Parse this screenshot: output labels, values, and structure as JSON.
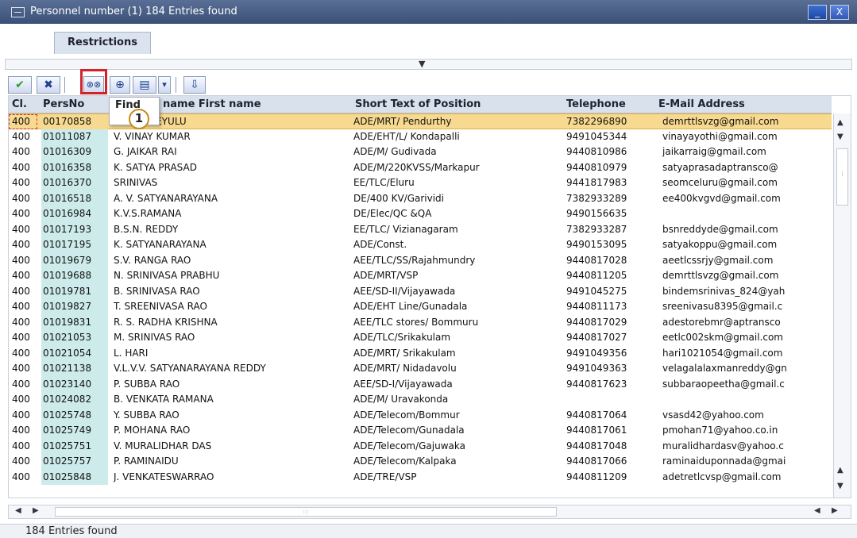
{
  "window": {
    "title": "Personnel number (1)  184 Entries found",
    "minimize_label": "_",
    "close_label": "X"
  },
  "tabs": [
    {
      "label": "Restrictions"
    }
  ],
  "toolbar": {
    "buttons": [
      {
        "name": "continue-button",
        "icon": "check-icon",
        "glyph": "✔"
      },
      {
        "name": "cancel-button",
        "icon": "close-icon",
        "glyph": "✖"
      },
      {
        "name": "find-button",
        "icon": "binoculars-icon",
        "glyph": "⊗⊗"
      },
      {
        "name": "find-next-button",
        "icon": "binoculars-next-icon",
        "glyph": "⊕"
      },
      {
        "name": "print-button",
        "icon": "printer-icon",
        "glyph": "▤"
      },
      {
        "name": "dropdown-button",
        "icon": "dropdown-icon",
        "glyph": "▾"
      },
      {
        "name": "hierarchy-button",
        "icon": "hierarchy-icon",
        "glyph": "⇩"
      }
    ]
  },
  "tooltip": {
    "text": "Find"
  },
  "callout": {
    "number": "1"
  },
  "table": {
    "columns": [
      "Cl.",
      "PersNo",
      "name First name",
      "Short Text of Position",
      "Telephone",
      "E-Mail Address"
    ],
    "rows": [
      [
        "400",
        "00170858",
        "ERANJANEYULU",
        "ADE/MRT/ Pendurthy",
        "7382296890",
        "demrttlsvzg@gmail.com"
      ],
      [
        "400",
        "01011087",
        "V. VINAY KUMAR",
        "ADE/EHT/L/ Kondapalli",
        "9491045344",
        "vinayayothi@gmail.com"
      ],
      [
        "400",
        "01016309",
        "G. JAIKAR RAI",
        "ADE/M/ Gudivada",
        "9440810986",
        "jaikarraig@gmail.com"
      ],
      [
        "400",
        "01016358",
        "K. SATYA PRASAD",
        "ADE/M/220KVSS/Markapur",
        "9440810979",
        "satyaprasadaptransco@"
      ],
      [
        "400",
        "01016370",
        "SRINIVAS",
        "EE/TLC/Eluru",
        "9441817983",
        "seomceluru@gmail.com"
      ],
      [
        "400",
        "01016518",
        "A. V. SATYANARAYANA",
        "DE/400 KV/Garividi",
        "7382933289",
        "ee400kvgvd@gmail.com"
      ],
      [
        "400",
        "01016984",
        "K.V.S.RAMANA",
        "DE/Elec/QC &QA",
        "9490156635",
        ""
      ],
      [
        "400",
        "01017193",
        "B.S.N. REDDY",
        "EE/TLC/ Vizianagaram",
        "7382933287",
        "bsnreddyde@gmail.com"
      ],
      [
        "400",
        "01017195",
        "K. SATYANARAYANA",
        "ADE/Const.",
        "9490153095",
        "satyakoppu@gmail.com"
      ],
      [
        "400",
        "01019679",
        "S.V. RANGA RAO",
        "AEE/TLC/SS/Rajahmundry",
        "9440817028",
        "aeetlcssrjy@gmail.com"
      ],
      [
        "400",
        "01019688",
        "N. SRINIVASA PRABHU",
        "ADE/MRT/VSP",
        "9440811205",
        "demrttlsvzg@gmail.com"
      ],
      [
        "400",
        "01019781",
        "B. SRINIVASA RAO",
        "AEE/SD-II/Vijayawada",
        "9491045275",
        "bindemsrinivas_824@yah"
      ],
      [
        "400",
        "01019827",
        "T. SREENIVASA RAO",
        "ADE/EHT Line/Gunadala",
        "9440811173",
        "sreenivasu8395@gmail.c"
      ],
      [
        "400",
        "01019831",
        "R. S. RADHA KRISHNA",
        "AEE/TLC stores/ Bommuru",
        "9440817029",
        "adestorebmr@aptransco"
      ],
      [
        "400",
        "01021053",
        "M. SRINIVAS RAO",
        "ADE/TLC/Srikakulam",
        "9440817027",
        "eetlc002skm@gmail.com"
      ],
      [
        "400",
        "01021054",
        "L. HARI",
        "ADE/MRT/ Srikakulam",
        "9491049356",
        "hari1021054@gmail.com"
      ],
      [
        "400",
        "01021138",
        "V.L.V.V. SATYANARAYANA REDDY",
        "ADE/MRT/ Nidadavolu",
        "9491049363",
        "velagalalaxmanreddy@gn"
      ],
      [
        "400",
        "01023140",
        "P. SUBBA RAO",
        "AEE/SD-I/Vijayawada",
        "9440817623",
        "subbaraopeetha@gmail.c"
      ],
      [
        "400",
        "01024082",
        "B. VENKATA RAMANA",
        "ADE/M/ Uravakonda",
        "",
        ""
      ],
      [
        "400",
        "01025748",
        "Y. SUBBA RAO",
        "ADE/Telecom/Bommur",
        "9440817064",
        "vsasd42@yahoo.com"
      ],
      [
        "400",
        "01025749",
        "P. MOHANA RAO",
        "ADE/Telecom/Gunadala",
        "9440817061",
        "pmohan71@yahoo.co.in"
      ],
      [
        "400",
        "01025751",
        "V. MURALIDHAR DAS",
        "ADE/Telecom/Gajuwaka",
        "9440817048",
        "muralidhardasv@yahoo.c"
      ],
      [
        "400",
        "01025757",
        "P. RAMINAIDU",
        "ADE/Telecom/Kalpaka",
        "9440817066",
        "raminaiduponnada@gmai"
      ],
      [
        "400",
        "01025848",
        "J. VENKATESWARRAO",
        "ADE/TRE/VSP",
        "9440811209",
        "adetretlcvsp@gmail.com"
      ]
    ]
  },
  "status": {
    "text": "184 Entries found"
  },
  "colors": {
    "title_bar": "#3b5078",
    "selected_row": "#f7d98f",
    "persno_column": "#ccebea",
    "highlight": "#d3232a"
  }
}
